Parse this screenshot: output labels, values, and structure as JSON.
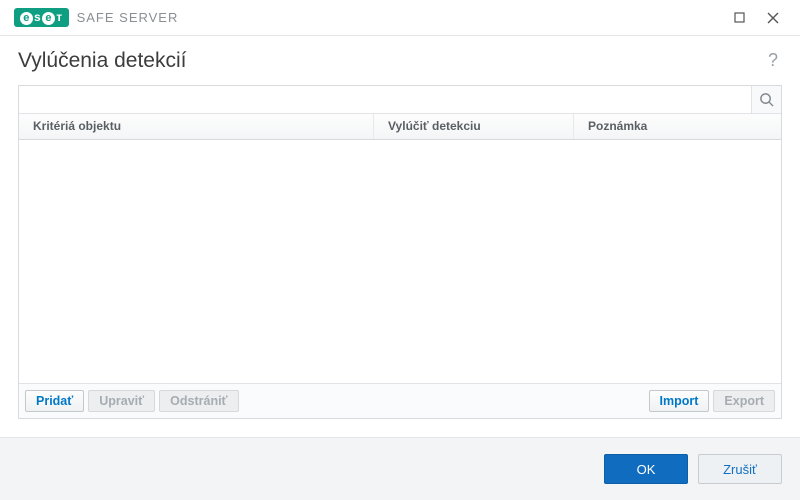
{
  "titlebar": {
    "brand_short": "eset",
    "product_name": "SAFE SERVER"
  },
  "heading": "Vylúčenia detekcií",
  "search": {
    "value": "",
    "placeholder": ""
  },
  "columns": {
    "object_criteria": "Kritériá objektu",
    "exclude_detection": "Vylúčiť detekciu",
    "note": "Poznámka"
  },
  "rows": [],
  "actions": {
    "add": "Pridať",
    "edit": "Upraviť",
    "delete": "Odstrániť",
    "import": "Import",
    "export": "Export"
  },
  "footer": {
    "ok": "OK",
    "cancel": "Zrušiť"
  }
}
